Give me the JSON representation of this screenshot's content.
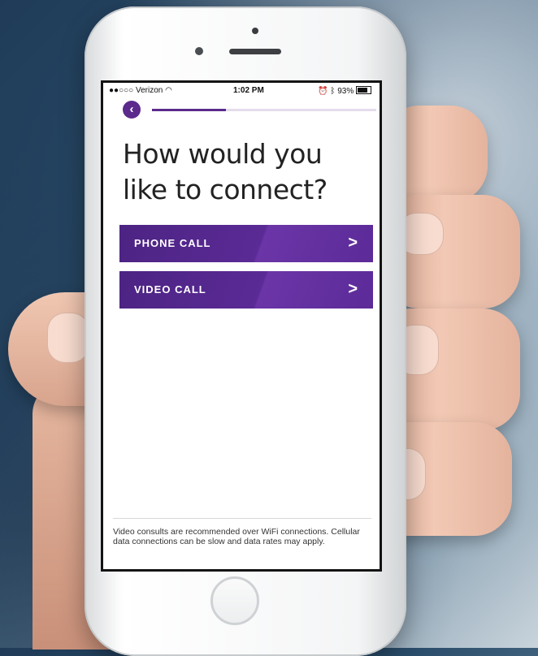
{
  "status_bar": {
    "carrier": "●●○○○ Verizon",
    "time": "1:02 PM",
    "battery": "93%"
  },
  "progress": 0.33,
  "back_symbol": "‹",
  "title": "How would you like to connect?",
  "options": [
    {
      "label": "PHONE CALL",
      "chevron": ">"
    },
    {
      "label": "VIDEO CALL",
      "chevron": ">"
    }
  ],
  "footer_note": "Video consults are recommended over WiFi connections. Cellular data connections can be slow and data rates may apply.",
  "colors": {
    "accent": "#5b2a8c",
    "button": "#5a2a95"
  },
  "icons": [
    "wifi-icon",
    "alarm-icon",
    "bluetooth-icon",
    "battery-icon",
    "back-arrow-icon",
    "chevron-right-icon"
  ]
}
